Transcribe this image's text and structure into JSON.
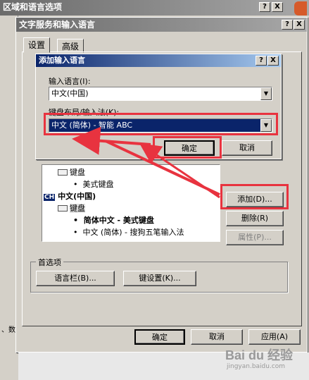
{
  "outer_window": {
    "title": "区域和语言选项",
    "controls": [
      "?",
      "X"
    ],
    "left_fragment": "、数"
  },
  "dialog": {
    "title": "文字服务和输入语言",
    "controls": [
      "?",
      "X"
    ],
    "tabs": [
      {
        "label": "设置",
        "active": true
      },
      {
        "label": "高级",
        "active": false
      }
    ],
    "installed_list": [
      {
        "type": "keyboard-header",
        "label": "键盘"
      },
      {
        "type": "layout",
        "label": "美式键盘"
      },
      {
        "type": "language",
        "badge": "CH",
        "label": "中文(中国)"
      },
      {
        "type": "keyboard-header",
        "label": "键盘"
      },
      {
        "type": "layout-bold",
        "label": "简体中文 - 美式键盘"
      },
      {
        "type": "layout",
        "label": "中文 (简体) - 搜狗五笔输入法"
      }
    ],
    "side_buttons": {
      "add": "添加(D)...",
      "remove": "删除(R)",
      "properties": "属性(P)..."
    },
    "preferences": {
      "group_label": "首选项",
      "language_bar_button": "语言栏(B)...",
      "key_settings_button": "键设置(K)..."
    },
    "footer": {
      "ok": "确定",
      "cancel": "取消",
      "apply": "应用(A)"
    }
  },
  "add_language_dialog": {
    "title": "添加输入语言",
    "controls": [
      "?",
      "X"
    ],
    "input_language_label": "输入语言(I):",
    "input_language_value": "中文(中国)",
    "keyboard_layout_label": "键盘布局/输入法(K):",
    "keyboard_layout_value": "中文 (简体) - 智能 ABC",
    "ok": "确定",
    "cancel": "取消"
  },
  "watermark": {
    "main": "Bai du 经验",
    "sub": "jingyan.baidu.com"
  },
  "colors": {
    "annotation_red": "#e8333f",
    "active_title": "#0a246a",
    "window_face": "#d4d0c8"
  }
}
